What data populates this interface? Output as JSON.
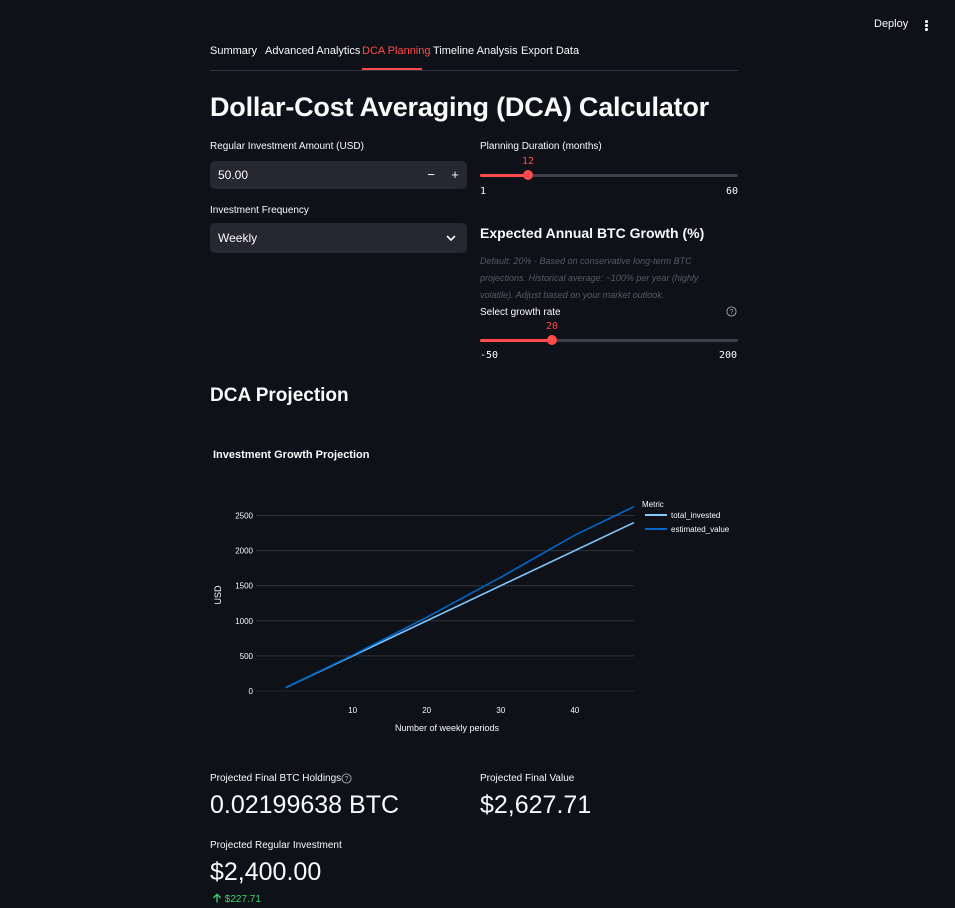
{
  "header": {
    "deploy_label": "Deploy",
    "menu_icon": "kebab-menu-icon"
  },
  "tabs": [
    {
      "label": "Summary",
      "active": false
    },
    {
      "label": "Advanced Analytics",
      "active": false
    },
    {
      "label": "DCA Planning",
      "active": true
    },
    {
      "label": "Timeline Analysis",
      "active": false
    },
    {
      "label": "Export Data",
      "active": false
    }
  ],
  "page_title": "Dollar-Cost Averaging (DCA) Calculator",
  "investment_amount": {
    "label": "Regular Investment Amount (USD)",
    "value": "50.00",
    "minus": "−",
    "plus": "+"
  },
  "frequency": {
    "label": "Investment Frequency",
    "value": "Weekly"
  },
  "duration": {
    "label": "Planning Duration (months)",
    "value": "12",
    "min": "1",
    "max": "60",
    "fraction": 0.186
  },
  "growth": {
    "heading": "Expected Annual BTC Growth (%)",
    "caption": "Default: 20% - Based on conservative long-term BTC projections. Historical average: ~100% per year (highly volatile). Adjust based on your market outlook.",
    "label": "Select growth rate",
    "value": "20",
    "min": "-50",
    "max": "200",
    "fraction": 0.28
  },
  "projection": {
    "heading": "DCA Projection"
  },
  "chart_data": {
    "type": "line",
    "title": "Investment Growth Projection",
    "xlabel": "Number of weekly periods",
    "ylabel": "USD",
    "xlim": [
      1,
      48
    ],
    "ylim": [
      0,
      2650
    ],
    "xticks": [
      10,
      20,
      30,
      40
    ],
    "yticks": [
      0,
      500,
      1000,
      1500,
      2000,
      2500
    ],
    "legend_title": "Metric",
    "legend_position": "top-right",
    "grid": true,
    "series": [
      {
        "name": "total_invested",
        "color": "#83c9ff",
        "x": [
          1,
          48
        ],
        "y": [
          50,
          2400
        ]
      },
      {
        "name": "estimated_value",
        "color": "#0068c9",
        "x": [
          1,
          10,
          20,
          30,
          40,
          48
        ],
        "y": [
          50,
          510,
          1050,
          1620,
          2220,
          2627.71
        ]
      }
    ]
  },
  "metrics": {
    "btc_holdings": {
      "label": "Projected Final BTC Holdings",
      "value": "0.02199638 BTC"
    },
    "final_value": {
      "label": "Projected Final Value",
      "value": "$2,627.71"
    },
    "regular_investment": {
      "label": "Projected Regular Investment",
      "value": "$2,400.00",
      "delta": "$227.71"
    }
  }
}
